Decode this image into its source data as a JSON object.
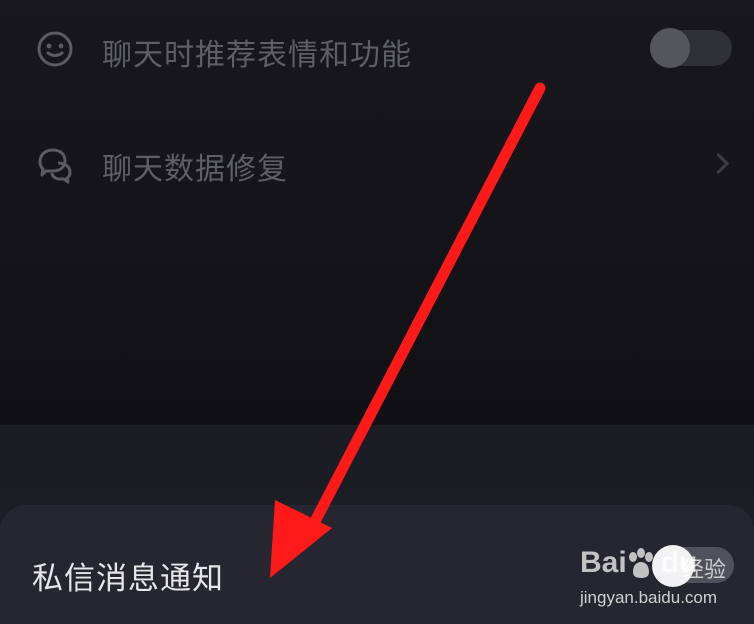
{
  "settings": {
    "items": [
      {
        "label": "聊天时推荐表情和功能",
        "icon": "emoji-face-icon",
        "control": "toggle",
        "enabled": false
      },
      {
        "label": "聊天数据修复",
        "icon": "chat-bubbles-icon",
        "control": "chevron"
      }
    ]
  },
  "sheet": {
    "label": "私信消息通知",
    "toggle_enabled": false
  },
  "annotation": {
    "color": "#ff1a1a",
    "icon": "red-arrow-annotation"
  },
  "watermark": {
    "brand": "Bai",
    "brand_suffix": "du",
    "product": "经验",
    "url": "jingyan.baidu.com"
  },
  "colors": {
    "background": "#14141a",
    "sheet": "#25262f",
    "dim_text": "#5d5e66",
    "bright_text": "#e6e6ea"
  }
}
